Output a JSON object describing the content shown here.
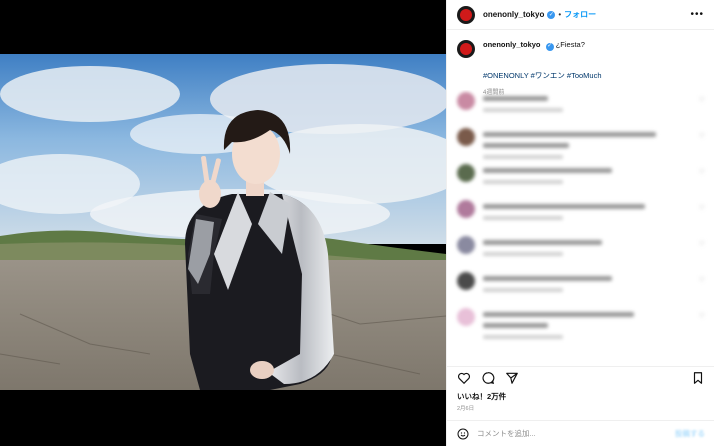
{
  "header": {
    "username": "onenonly_tokyo",
    "separator": "•",
    "follow_label": "フォロー",
    "more_label": "•••"
  },
  "caption": {
    "username": "onenonly_tokyo",
    "text": "¿Fiesta?",
    "hashtags": "#ONENONLY #ワンエン #TooMuch",
    "age": "4週間前"
  },
  "comments": [
    {
      "avatar_color": "#c98aa3"
    },
    {
      "avatar_color": "#7a5a4a"
    },
    {
      "avatar_color": "#5a6b4e"
    },
    {
      "avatar_color": "#b07a9c"
    },
    {
      "avatar_color": "#8a8aa0"
    },
    {
      "avatar_color": "#4a4a4a"
    },
    {
      "avatar_color": "#e8c0d8"
    }
  ],
  "actions": {
    "like_icon": "heart-icon",
    "comment_icon": "comment-icon",
    "share_icon": "paper-plane-icon",
    "save_icon": "bookmark-icon"
  },
  "likes": "いいね！2万件",
  "date": "2月6日",
  "comment_box": {
    "placeholder": "コメントを追加...",
    "post_label": "投稿する"
  },
  "colors": {
    "link": "#00376b",
    "follow": "#0095f6",
    "brand_red": "#d11a1a"
  }
}
